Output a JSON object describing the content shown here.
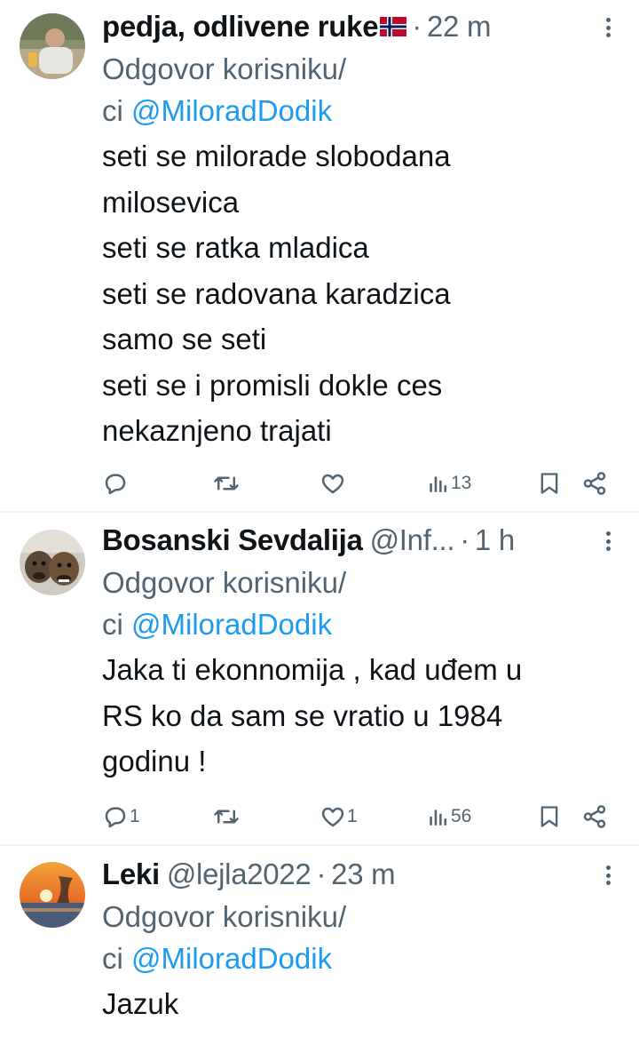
{
  "tweets": [
    {
      "name": "pedja, odlivene ruke",
      "handle": "",
      "flag": "norway-flag-emoji",
      "separator": "·",
      "time": "22 m",
      "reply_line1": "Odgovor korisniku/",
      "reply_line2_prefix": "ci ",
      "reply_mention": "@MiloradDodik",
      "text_lines": [
        "seti se milorade slobodana",
        "milosevica",
        "seti se ratka mladica",
        "seti se radovana karadzica",
        "samo se seti",
        "seti se i promisli dokle ces",
        "nekaznjeno trajati"
      ],
      "replies": "",
      "retweets": "",
      "likes": "",
      "views": "13"
    },
    {
      "name": "Bosanski Sevdalija",
      "handle": "@Inf...",
      "separator": "·",
      "time": "1 h",
      "reply_line1": "Odgovor korisniku/",
      "reply_line2_prefix": "ci ",
      "reply_mention": "@MiloradDodik",
      "text_lines": [
        "Jaka ti ekonnomija , kad uđem u",
        "RS ko da sam se vratio u 1984",
        "godinu !"
      ],
      "replies": "1",
      "retweets": "",
      "likes": "1",
      "views": "56"
    },
    {
      "name": "Leki",
      "handle": "@lejla2022",
      "separator": "·",
      "time": "23 m",
      "reply_line1": "Odgovor korisniku/",
      "reply_line2_prefix": "ci ",
      "reply_mention": "@MiloradDodik",
      "text_lines": [
        "Jazuk"
      ]
    }
  ],
  "colors": {
    "text": "#0f1419",
    "secondary": "#536471",
    "link": "#1d9bf0",
    "divider": "#eff3f4"
  }
}
